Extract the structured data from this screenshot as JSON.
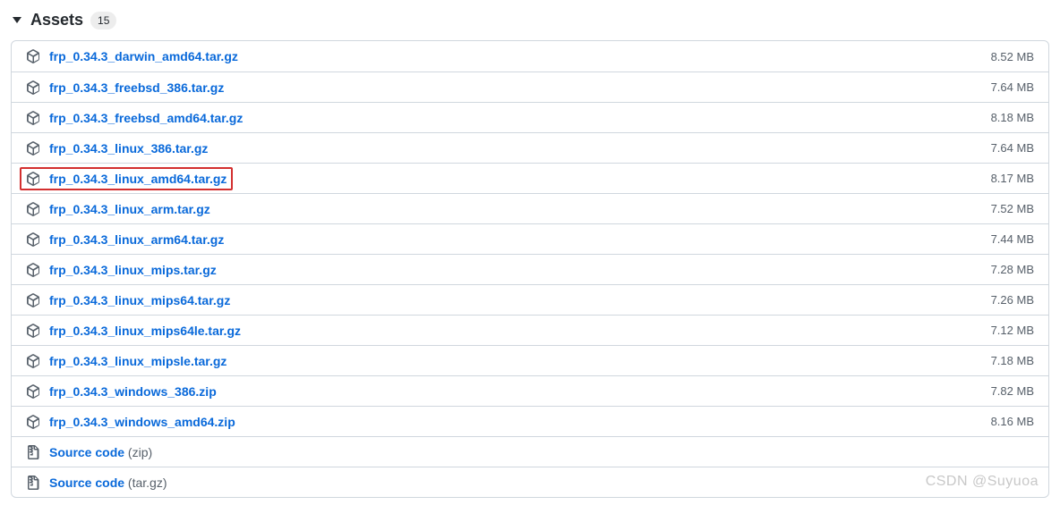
{
  "section": {
    "title": "Assets",
    "count": "15"
  },
  "assets": [
    {
      "name": "frp_0.34.3_darwin_amd64.tar.gz",
      "size": "8.52 MB",
      "icon": "package",
      "highlighted": false
    },
    {
      "name": "frp_0.34.3_freebsd_386.tar.gz",
      "size": "7.64 MB",
      "icon": "package",
      "highlighted": false
    },
    {
      "name": "frp_0.34.3_freebsd_amd64.tar.gz",
      "size": "8.18 MB",
      "icon": "package",
      "highlighted": false
    },
    {
      "name": "frp_0.34.3_linux_386.tar.gz",
      "size": "7.64 MB",
      "icon": "package",
      "highlighted": false
    },
    {
      "name": "frp_0.34.3_linux_amd64.tar.gz",
      "size": "8.17 MB",
      "icon": "package",
      "highlighted": true
    },
    {
      "name": "frp_0.34.3_linux_arm.tar.gz",
      "size": "7.52 MB",
      "icon": "package",
      "highlighted": false
    },
    {
      "name": "frp_0.34.3_linux_arm64.tar.gz",
      "size": "7.44 MB",
      "icon": "package",
      "highlighted": false
    },
    {
      "name": "frp_0.34.3_linux_mips.tar.gz",
      "size": "7.28 MB",
      "icon": "package",
      "highlighted": false
    },
    {
      "name": "frp_0.34.3_linux_mips64.tar.gz",
      "size": "7.26 MB",
      "icon": "package",
      "highlighted": false
    },
    {
      "name": "frp_0.34.3_linux_mips64le.tar.gz",
      "size": "7.12 MB",
      "icon": "package",
      "highlighted": false
    },
    {
      "name": "frp_0.34.3_linux_mipsle.tar.gz",
      "size": "7.18 MB",
      "icon": "package",
      "highlighted": false
    },
    {
      "name": "frp_0.34.3_windows_386.zip",
      "size": "7.82 MB",
      "icon": "package",
      "highlighted": false
    },
    {
      "name": "frp_0.34.3_windows_amd64.zip",
      "size": "8.16 MB",
      "icon": "package",
      "highlighted": false
    },
    {
      "name": "Source code",
      "suffix": "(zip)",
      "size": "",
      "icon": "zip",
      "highlighted": false
    },
    {
      "name": "Source code",
      "suffix": "(tar.gz)",
      "size": "",
      "icon": "zip",
      "highlighted": false
    }
  ],
  "watermark": "CSDN @Suyuoa"
}
